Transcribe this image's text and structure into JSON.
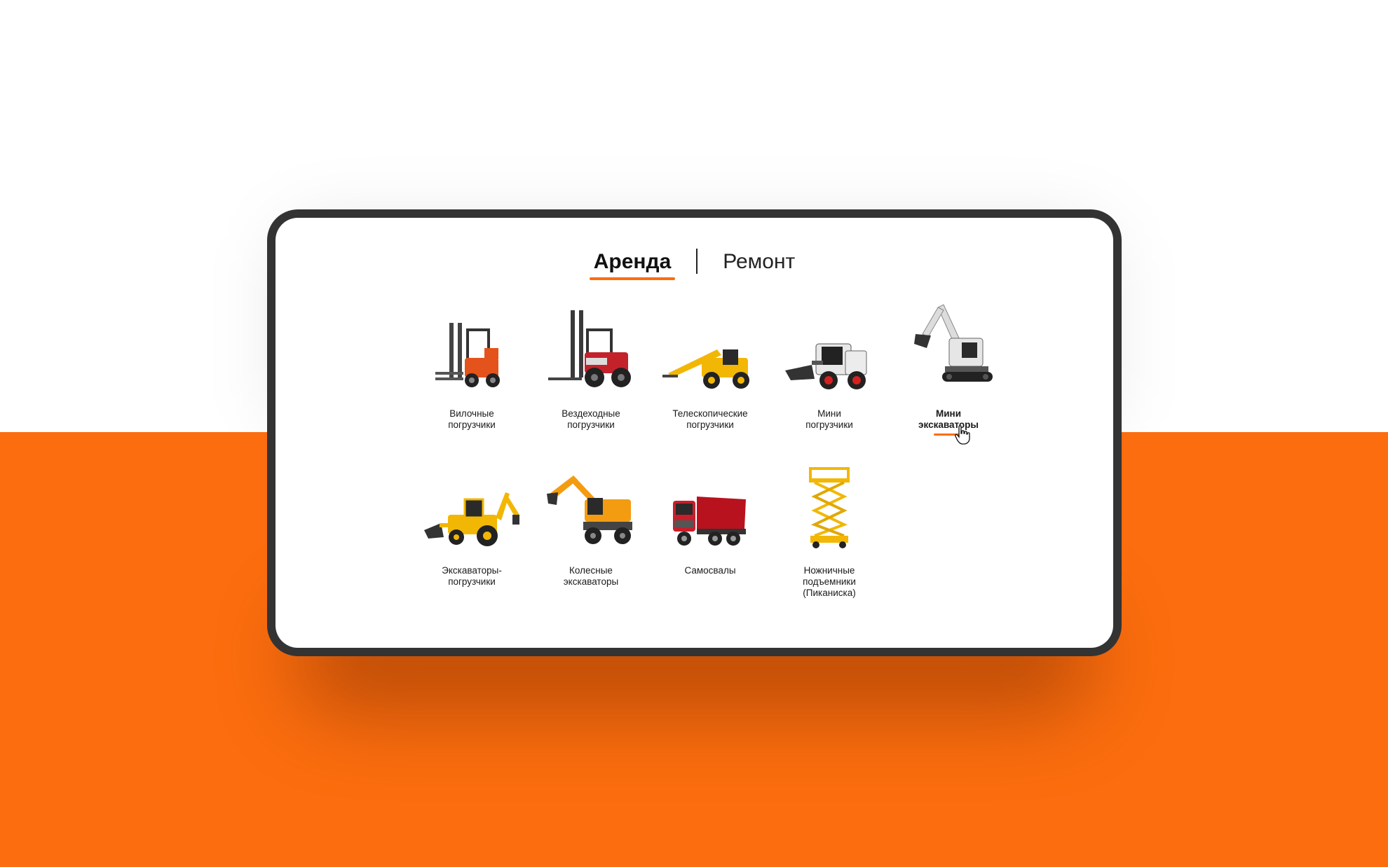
{
  "tabs": [
    {
      "label": "Аренда",
      "active": true
    },
    {
      "label": "Ремонт",
      "active": false
    }
  ],
  "items": [
    {
      "label": "Вилочные\nпогрузчики",
      "icon": "forklift-icon"
    },
    {
      "label": "Вездеходные\nпогрузчики",
      "icon": "rough-terrain-forklift-icon"
    },
    {
      "label": "Телескопические\nпогрузчики",
      "icon": "telehandler-icon"
    },
    {
      "label": "Мини\nпогрузчики",
      "icon": "skid-steer-loader-icon"
    },
    {
      "label": "Мини\nэкскаваторы",
      "icon": "mini-excavator-icon",
      "selected": true
    },
    {
      "label": "Экскаваторы-\nпогрузчики",
      "icon": "backhoe-loader-icon"
    },
    {
      "label": "Колесные\nэкскаваторы",
      "icon": "wheeled-excavator-icon"
    },
    {
      "label": "Самосвалы",
      "icon": "dump-truck-icon"
    },
    {
      "label": "Ножничные\nподъемники\n(Пиканиска)",
      "icon": "scissor-lift-icon"
    }
  ],
  "colors": {
    "accent": "#fb6d0e",
    "frame": "#333333"
  }
}
